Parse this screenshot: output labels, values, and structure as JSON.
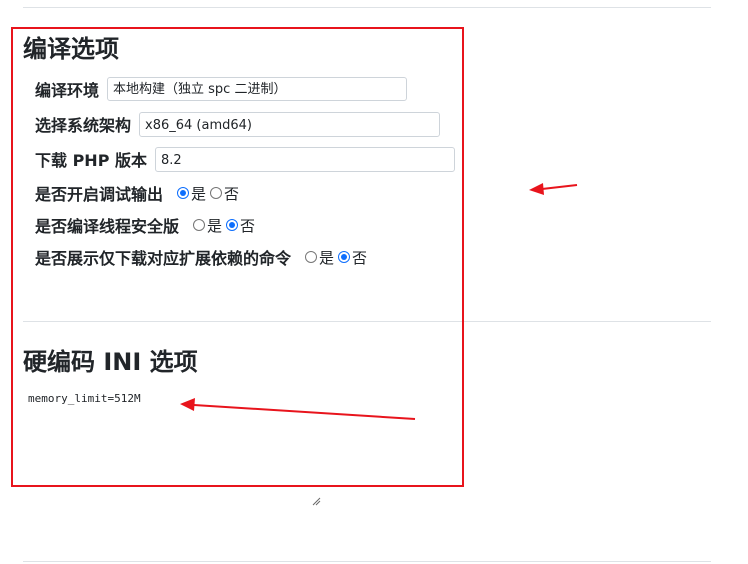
{
  "compile_options": {
    "title": "编译选项",
    "build_env": {
      "label": "编译环境",
      "value": "本地构建（独立 spc 二进制）"
    },
    "arch": {
      "label": "选择系统架构",
      "value": "x86_64 (amd64)"
    },
    "php_version": {
      "label": "下载 PHP 版本",
      "value": "8.2"
    },
    "debug_output": {
      "label": "是否开启调试输出",
      "yes": "是",
      "no": "否",
      "selected": "yes"
    },
    "thread_safe": {
      "label": "是否编译线程安全版",
      "yes": "是",
      "no": "否",
      "selected": "no"
    },
    "show_download_deps": {
      "label": "是否展示仅下载对应扩展依赖的命令",
      "yes": "是",
      "no": "否",
      "selected": "no"
    }
  },
  "ini_options": {
    "title": "硬编码 INI 选项",
    "content": "memory_limit=512M"
  },
  "colors": {
    "highlight": "#e8141c",
    "accent": "#0d6efd"
  },
  "icons": [
    "radio-icon",
    "resize-handle-icon",
    "arrow-annotation"
  ]
}
